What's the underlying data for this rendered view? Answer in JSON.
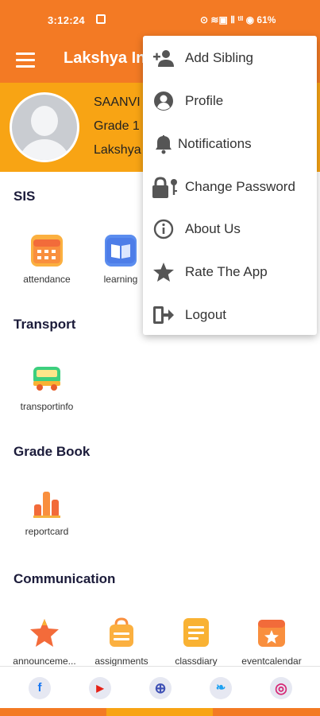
{
  "status_bar": {
    "time": "3:12:24",
    "indicators": "⊙ ≋▣ Ⅱ ᵗᴵᴵ ◉ 61%"
  },
  "app_bar": {
    "title": "Lakshya Int"
  },
  "profile": {
    "name": "SAANVI",
    "grade": "Grade 1",
    "school": "Lakshya"
  },
  "sections": {
    "sis": {
      "title": "SIS",
      "items": [
        {
          "label": "attendance",
          "icon": "calendar-icon"
        },
        {
          "label": "learning",
          "icon": "book-icon"
        }
      ]
    },
    "transport": {
      "title": "Transport",
      "items": [
        {
          "label": "transportinfo",
          "icon": "bus-icon"
        }
      ]
    },
    "gradebook": {
      "title": "Grade Book",
      "items": [
        {
          "label": "reportcard",
          "icon": "bar-chart-icon"
        }
      ]
    },
    "communication": {
      "title": "Communication",
      "items": [
        {
          "label": "announceme...",
          "icon": "star-icon"
        },
        {
          "label": "assignments",
          "icon": "bag-icon"
        },
        {
          "label": "classdiary",
          "icon": "notepad-icon"
        },
        {
          "label": "eventcalendar",
          "icon": "event-calendar-icon"
        }
      ]
    }
  },
  "social": [
    {
      "name": "facebook-icon",
      "glyph": "f",
      "color": "#1877f2"
    },
    {
      "name": "youtube-icon",
      "glyph": "▶",
      "color": "#e62117"
    },
    {
      "name": "globe-icon",
      "glyph": "⊕",
      "color": "#3f51b5"
    },
    {
      "name": "twitter-icon",
      "glyph": "❧",
      "color": "#1da1f2"
    },
    {
      "name": "instagram-icon",
      "glyph": "◎",
      "color": "#d62976"
    }
  ],
  "menu": {
    "items": [
      {
        "label": "Add Sibling",
        "icon": "add-person-icon"
      },
      {
        "label": "Profile",
        "icon": "user-circle-icon"
      },
      {
        "label": "Notifications",
        "icon": "bell-icon"
      },
      {
        "label": "Change Password",
        "icon": "lock-key-icon"
      },
      {
        "label": "About Us",
        "icon": "info-icon"
      },
      {
        "label": "Rate The App",
        "icon": "star-icon"
      },
      {
        "label": "Logout",
        "icon": "logout-icon"
      }
    ]
  },
  "colors": {
    "primary": "#f37a24",
    "accent": "#f8a414"
  }
}
